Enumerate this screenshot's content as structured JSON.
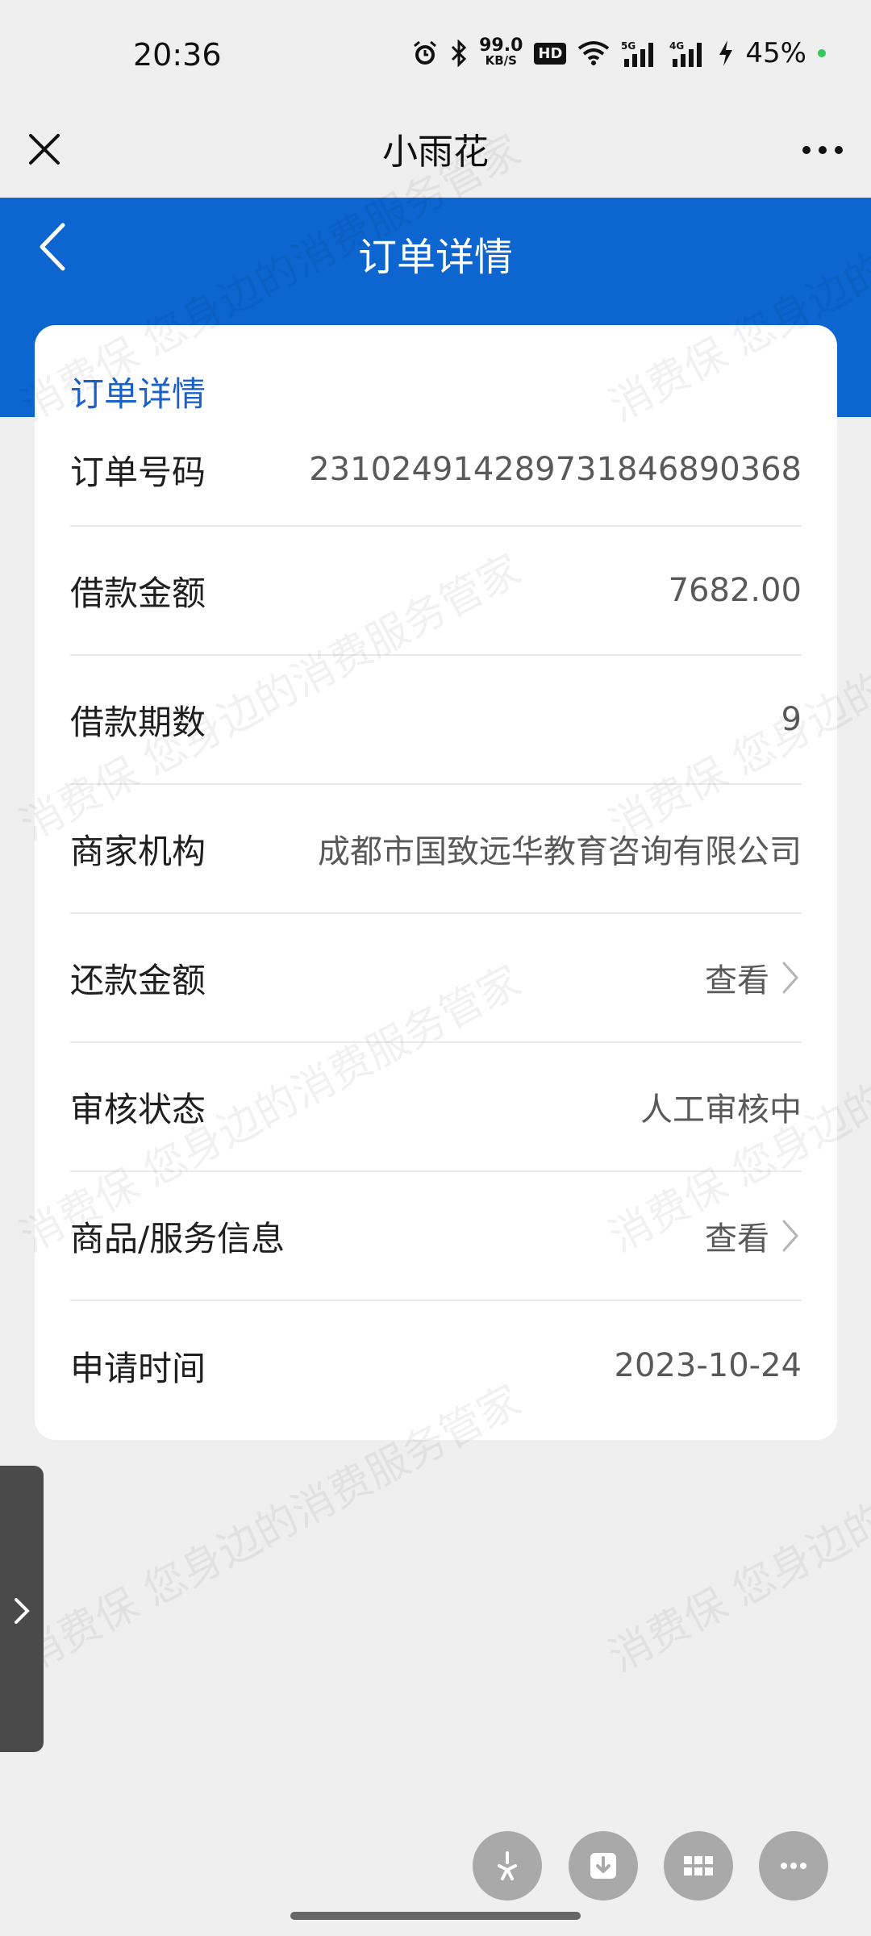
{
  "status_bar": {
    "time": "20:36",
    "net_speed_value": "99.0",
    "net_speed_unit": "KB/S",
    "hd_badge": "HD",
    "battery": "45%",
    "icons": [
      "alarm-icon",
      "bluetooth-icon",
      "hd-icon",
      "wifi-icon",
      "signal-5g-icon",
      "signal-4g-icon",
      "charging-icon"
    ]
  },
  "mp_nav": {
    "title": "小雨花"
  },
  "header": {
    "title": "订单详情",
    "color": "#0d66d0"
  },
  "card": {
    "section_title": "订单详情",
    "rows": [
      {
        "label": "订单号码",
        "value": "231024914289731846890368"
      },
      {
        "label": "借款金额",
        "value": "7682.00"
      },
      {
        "label": "借款期数",
        "value": "9"
      },
      {
        "label": "商家机构",
        "value": "成都市国致远华教育咨询有限公司"
      },
      {
        "label": "还款金额",
        "value": "查看"
      },
      {
        "label": "审核状态",
        "value": "人工审核中"
      },
      {
        "label": "商品/服务信息",
        "value": "查看"
      },
      {
        "label": "申请时间",
        "value": "2023-10-24"
      }
    ]
  },
  "watermark": {
    "text": "消费保 您身边的消费服务管家"
  }
}
